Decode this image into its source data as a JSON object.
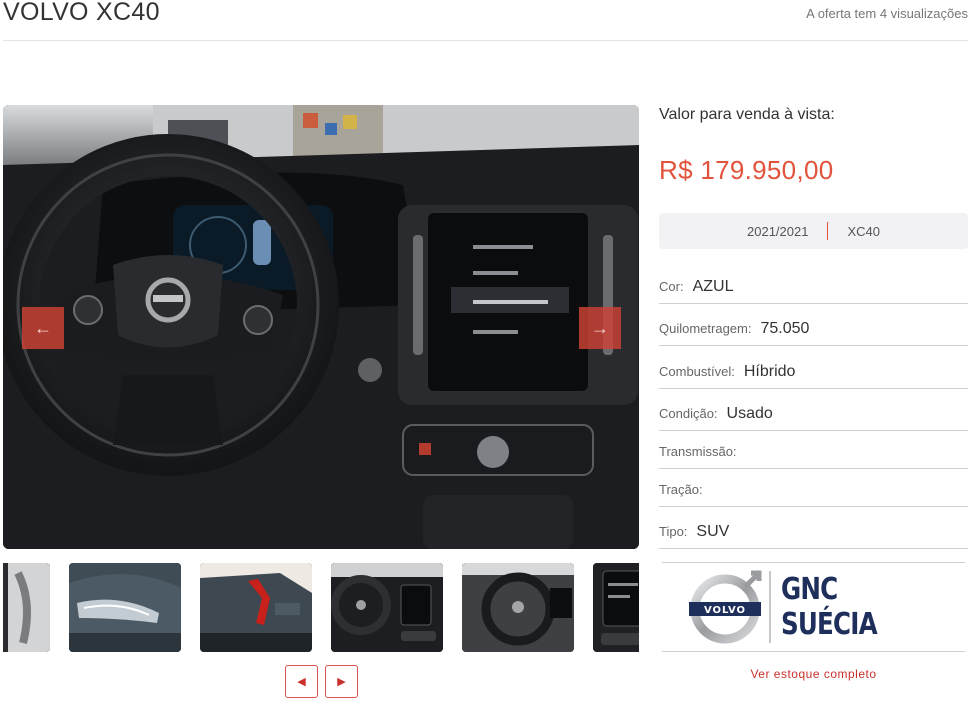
{
  "listing": {
    "title": "VOLVO XC40",
    "views_text": "A oferta tem 4 visualizações"
  },
  "gallery": {
    "prev_icon": "arrow-left-icon",
    "next_icon": "arrow-right-icon",
    "thumbnails": [
      "interior-detail",
      "headlight",
      "tail-light",
      "dashboard",
      "steering-wheel",
      "center-console"
    ],
    "pager_prev_icon": "caret-left-icon",
    "pager_next_icon": "caret-right-icon"
  },
  "pricing": {
    "label": "Valor para venda à vista:",
    "price": "R$ 179.950,00",
    "year": "2021/2021",
    "model": "XC40"
  },
  "specs": [
    {
      "key": "Cor:",
      "value": "AZUL"
    },
    {
      "key": "Quilometragem:",
      "value": "75.050"
    },
    {
      "key": "Combustível:",
      "value": "Híbrido"
    },
    {
      "key": "Condição:",
      "value": "Usado"
    },
    {
      "key": "Transmissão:",
      "value": ""
    },
    {
      "key": "Tração:",
      "value": ""
    },
    {
      "key": "Tipo:",
      "value": "SUV"
    }
  ],
  "dealer": {
    "badge_text": "VOLVO",
    "name": "GNC SUÉCIA",
    "stock_link": "Ver estoque completo"
  },
  "colors": {
    "accent": "#e2533c",
    "dealer_navy": "#1d2f5a"
  }
}
